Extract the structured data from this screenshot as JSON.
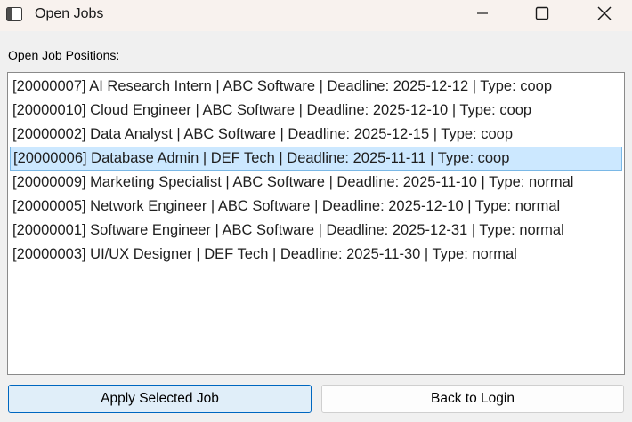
{
  "window": {
    "title": "Open Jobs",
    "controls": {
      "minimize_icon": "minimize-icon",
      "maximize_icon": "maximize-icon",
      "close_icon": "close-icon"
    }
  },
  "main": {
    "section_label": "Open Job Positions:",
    "jobs": [
      {
        "text": "[20000007] AI Research Intern | ABC Software | Deadline: 2025-12-12 | Type: coop",
        "selected": false
      },
      {
        "text": "[20000010] Cloud Engineer | ABC Software | Deadline: 2025-12-10 | Type: coop",
        "selected": false
      },
      {
        "text": "[20000002] Data Analyst | ABC Software | Deadline: 2025-12-15 | Type: coop",
        "selected": false
      },
      {
        "text": "[20000006] Database Admin | DEF Tech | Deadline: 2025-11-11 | Type: coop",
        "selected": true
      },
      {
        "text": "[20000009] Marketing Specialist | ABC Software | Deadline: 2025-11-10 | Type: normal",
        "selected": false
      },
      {
        "text": "[20000005] Network Engineer | ABC Software | Deadline: 2025-12-10 | Type: normal",
        "selected": false
      },
      {
        "text": "[20000001] Software Engineer | ABC Software | Deadline: 2025-12-31 | Type: normal",
        "selected": false
      },
      {
        "text": "[20000003] UI/UX Designer | DEF Tech | Deadline: 2025-11-30 | Type: normal",
        "selected": false
      }
    ]
  },
  "buttons": {
    "apply_label": "Apply Selected Job",
    "back_label": "Back to Login"
  },
  "colors": {
    "selection_background": "#cce8ff",
    "selection_border": "#7ab8e6",
    "focused_button_border": "#0067c0",
    "title_bar": "#f8f2ee"
  }
}
